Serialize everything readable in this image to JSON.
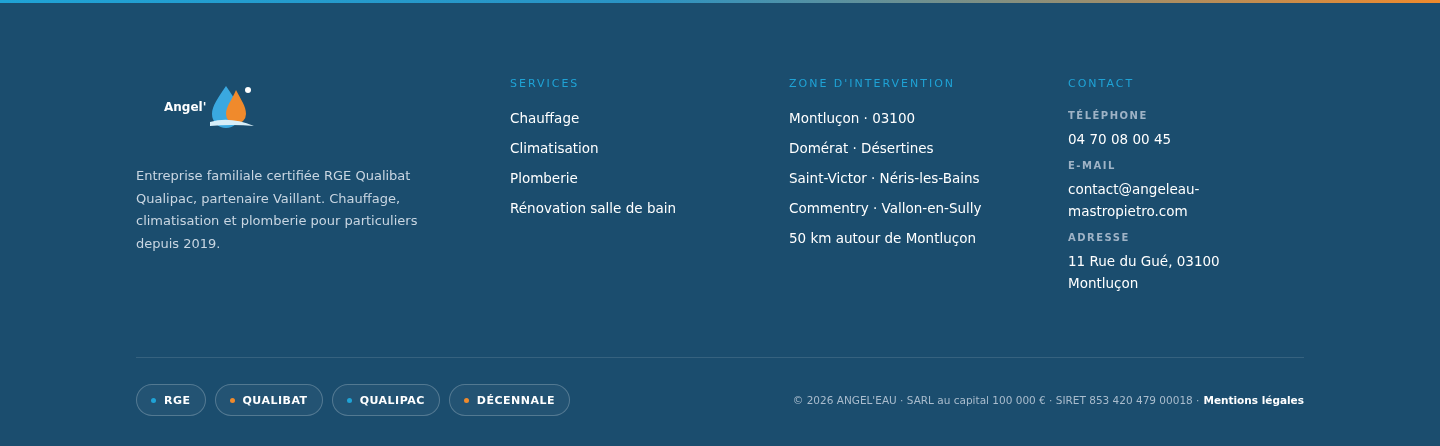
{
  "brand": {
    "logo_text": "Angel'",
    "description": "Entreprise familiale certifiée RGE Qualibat Qualipac, partenaire Vaillant. Chauffage, climatisation et plomberie pour particuliers depuis 2019."
  },
  "columns": [
    {
      "title": "SERVICES",
      "links": [
        "Chauffage",
        "Climatisation",
        "Plomberie",
        "Rénovation salle de bain"
      ]
    },
    {
      "title": "ZONE D'INTERVENTION",
      "links": [
        "Montluçon · 03100",
        "Domérat · Désertines",
        "Saint-Victor · Néris-les-Bains",
        "Commentry · Vallon-en-Sully",
        "50 km autour de Montluçon"
      ]
    }
  ],
  "contact": {
    "title": "CONTACT",
    "items": [
      {
        "label": "TÉLÉPHONE",
        "value": "04 70 08 00 45"
      },
      {
        "label": "E-MAIL",
        "value": "contact@angeleau-mastropietro.com"
      },
      {
        "label": "ADRESSE",
        "value": "11 Rue du Gué, 03100 Montluçon"
      }
    ]
  },
  "badges": [
    {
      "label": "RGE",
      "color": "#1fa3d6"
    },
    {
      "label": "QUALIBAT",
      "color": "#f08a2c"
    },
    {
      "label": "QUALIPAC",
      "color": "#1fa3d6"
    },
    {
      "label": "DÉCENNALE",
      "color": "#f08a2c"
    }
  ],
  "legal": {
    "text": "© 2026 ANGEL'EAU · SARL au capital 100 000 € · SIRET 853 420 479 00018 ·",
    "link": "Mentions légales"
  }
}
